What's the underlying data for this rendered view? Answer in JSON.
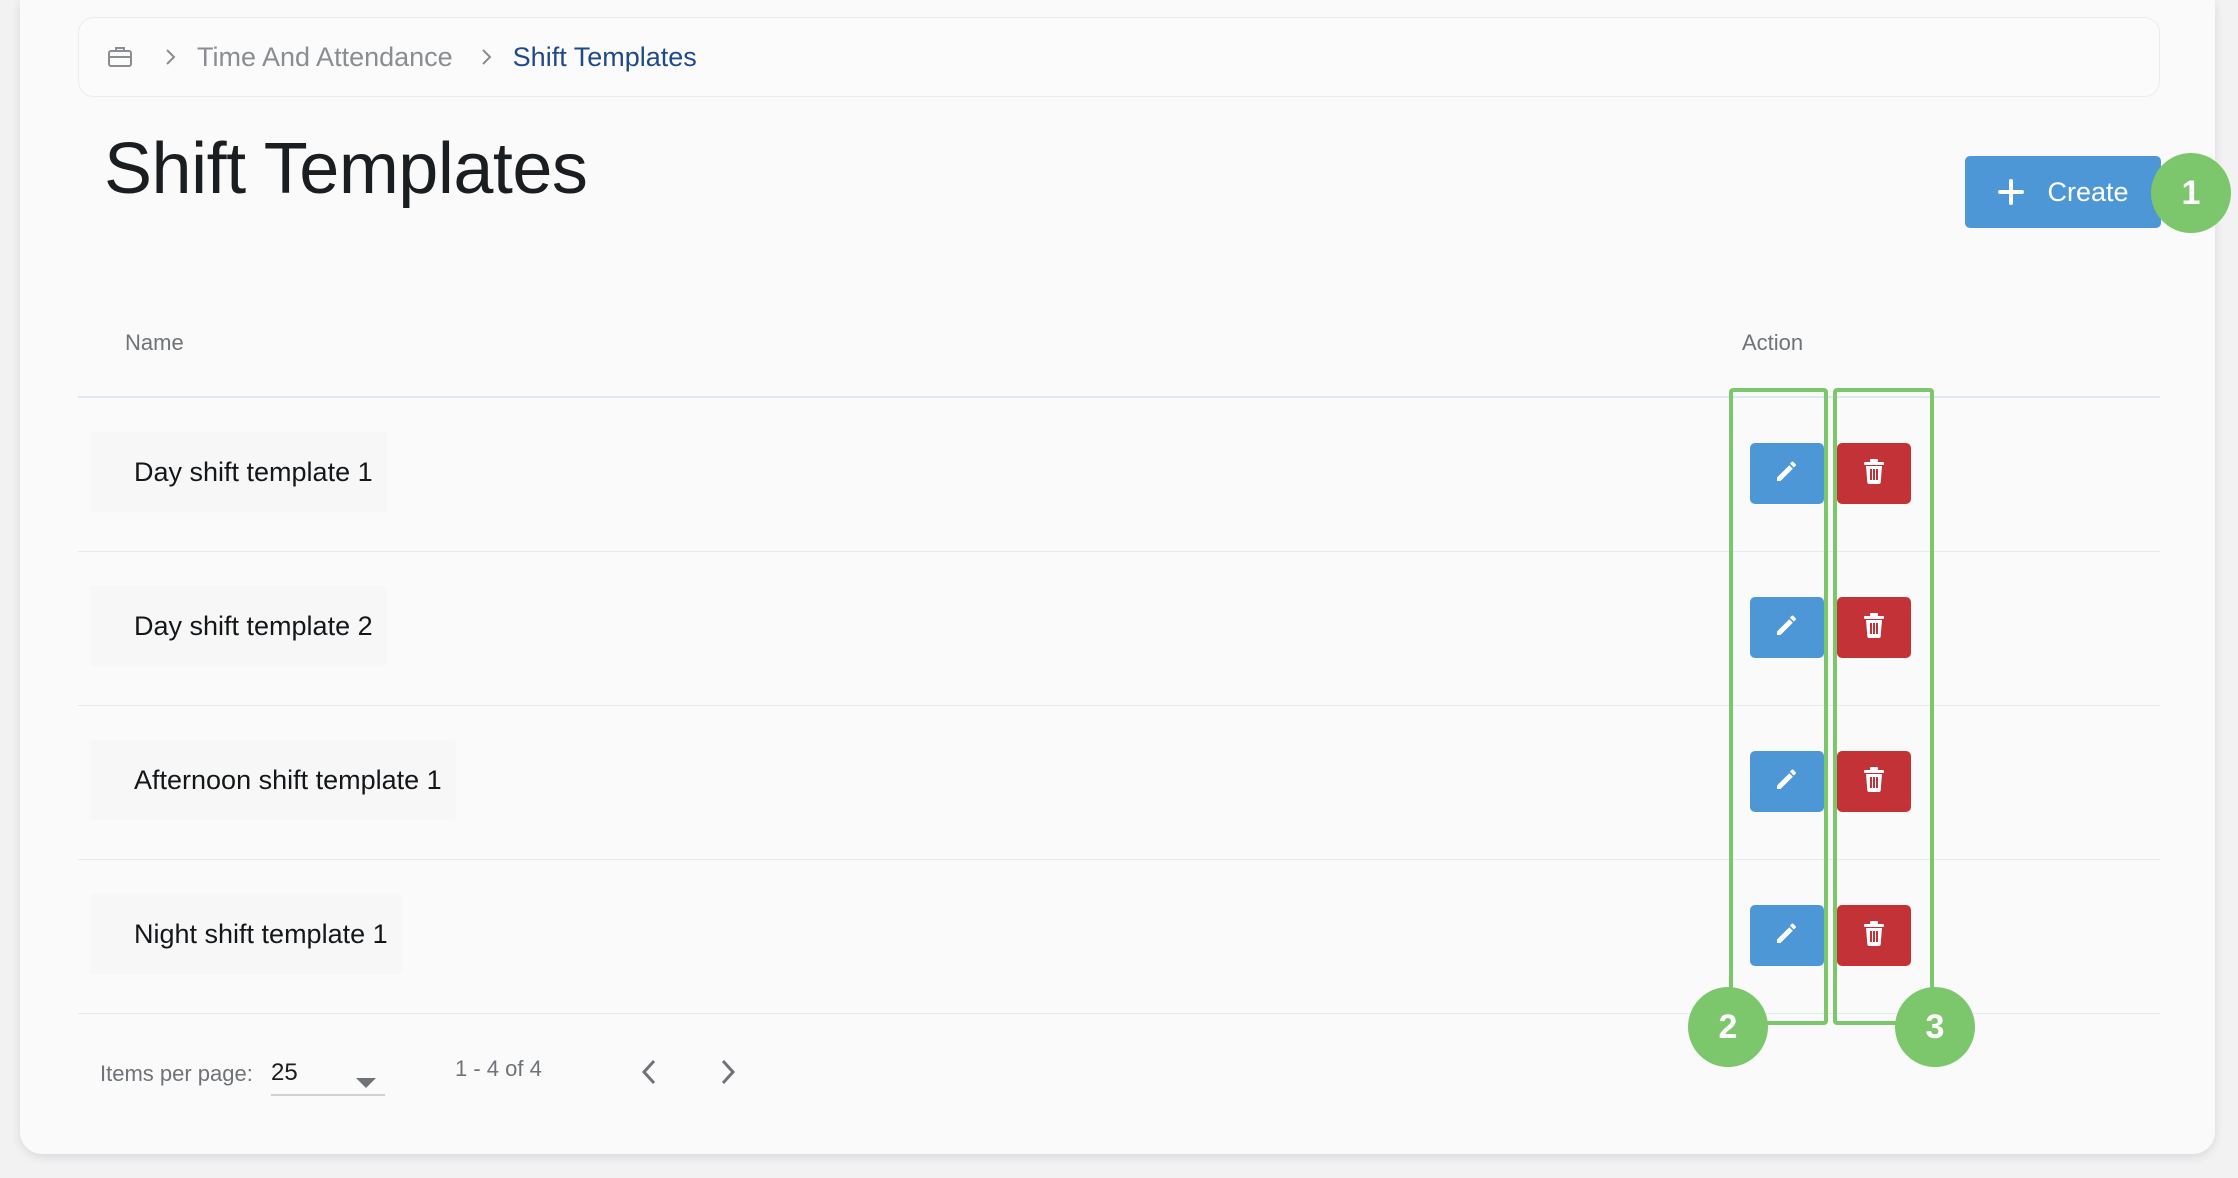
{
  "breadcrumb": {
    "home_icon": "briefcase-icon",
    "items": [
      "Time And Attendance",
      "Shift Templates"
    ]
  },
  "page": {
    "title": "Shift Templates",
    "create_label": "Create"
  },
  "table": {
    "columns": [
      "Name",
      "Action"
    ],
    "rows": [
      {
        "name": "Day shift template 1"
      },
      {
        "name": "Day shift template 2"
      },
      {
        "name": "Afternoon shift template 1"
      },
      {
        "name": "Night shift template 1"
      }
    ]
  },
  "annotations": {
    "badges": [
      "1",
      "2",
      "3"
    ],
    "color": "#7cc66b"
  },
  "pagination": {
    "items_per_page_label": "Items per page:",
    "items_per_page_value": "25",
    "range_text": "1 - 4 of 4"
  },
  "colors": {
    "primary": "#4d97d6",
    "danger": "#c23236",
    "breadcrumb_active": "#1f4a8a"
  }
}
